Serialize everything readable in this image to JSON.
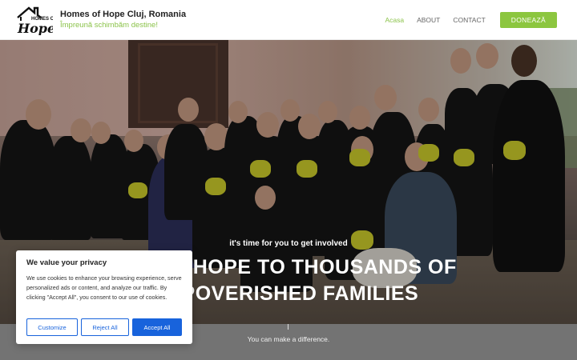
{
  "header": {
    "brand_title": "Homes of Hope Cluj, Romania",
    "brand_tagline": "Împreună schimbăm destine!",
    "logo_lines": [
      "Homes of",
      "Hope"
    ],
    "nav": [
      {
        "label": "Acasa",
        "active": true
      },
      {
        "label": "ABOUT",
        "active": false
      },
      {
        "label": "CONTACT",
        "active": false
      }
    ],
    "donate_label": "DONEAZĂ"
  },
  "hero": {
    "kicker": "it's time for you to get involved",
    "title_line1": "BRING HOPE TO THOUSANDS OF",
    "title_line2": "IMPOVERISHED FAMILIES",
    "image_alt": "group photo"
  },
  "band": {
    "text": "You can make a difference."
  },
  "cookie": {
    "title": "We value your privacy",
    "text": "We use cookies to enhance your browsing experience, serve personalized ads or content, and analyze our traffic. By clicking \"Accept All\", you consent to our use of cookies.",
    "customize_label": "Customize",
    "reject_label": "Reject All",
    "accept_label": "Accept All"
  },
  "colors": {
    "accent": "#8cc63f",
    "cookie_blue": "#1863dc",
    "band": "#737373"
  }
}
